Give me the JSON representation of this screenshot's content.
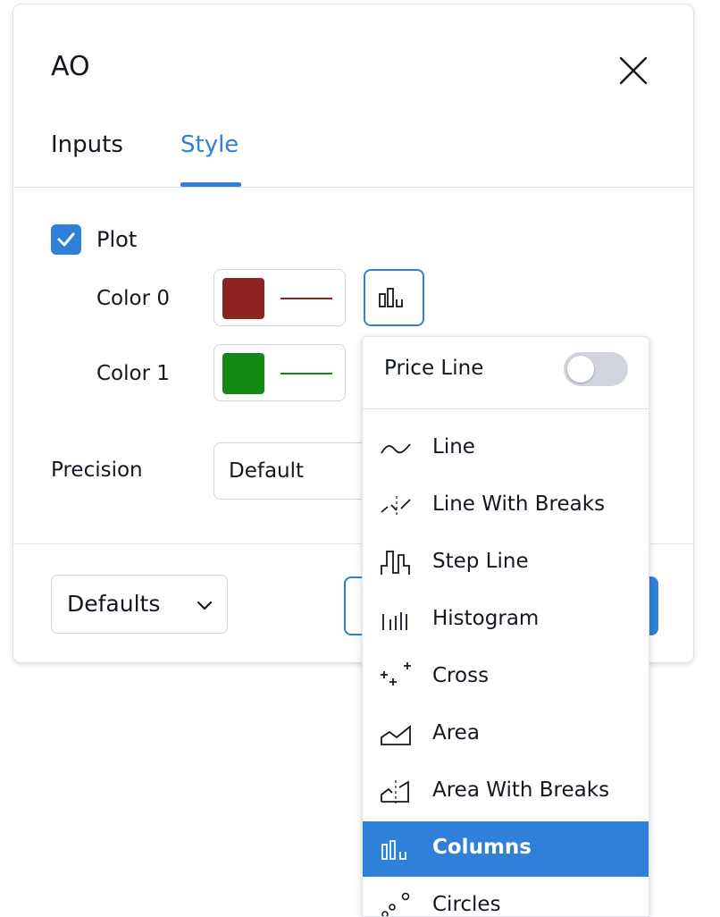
{
  "dialog": {
    "title": "AO",
    "tabs": [
      {
        "label": "Inputs",
        "active": false
      },
      {
        "label": "Style",
        "active": true
      }
    ]
  },
  "style": {
    "plot": {
      "label": "Plot",
      "checked": true
    },
    "colors": [
      {
        "label": "Color 0",
        "swatch": "#8e2421",
        "line_color": "#8e2421"
      },
      {
        "label": "Color 1",
        "swatch": "#128a12",
        "line_color": "#128a12"
      }
    ],
    "precision": {
      "label": "Precision",
      "value": "Default"
    }
  },
  "footer": {
    "defaults_label": "Defaults"
  },
  "plot_type_menu": {
    "price_line": {
      "label": "Price Line",
      "enabled": false
    },
    "items": [
      {
        "label": "Line",
        "icon": "line-icon",
        "selected": false
      },
      {
        "label": "Line With Breaks",
        "icon": "line-with-breaks-icon",
        "selected": false
      },
      {
        "label": "Step Line",
        "icon": "step-line-icon",
        "selected": false
      },
      {
        "label": "Histogram",
        "icon": "histogram-icon",
        "selected": false
      },
      {
        "label": "Cross",
        "icon": "cross-icon",
        "selected": false
      },
      {
        "label": "Area",
        "icon": "area-icon",
        "selected": false
      },
      {
        "label": "Area With Breaks",
        "icon": "area-with-breaks-icon",
        "selected": false
      },
      {
        "label": "Columns",
        "icon": "columns-icon",
        "selected": true
      },
      {
        "label": "Circles",
        "icon": "circles-icon",
        "selected": false
      }
    ]
  },
  "colors": {
    "accent": "#2f80d8",
    "border": "#d1d4dc",
    "text": "#131722"
  }
}
